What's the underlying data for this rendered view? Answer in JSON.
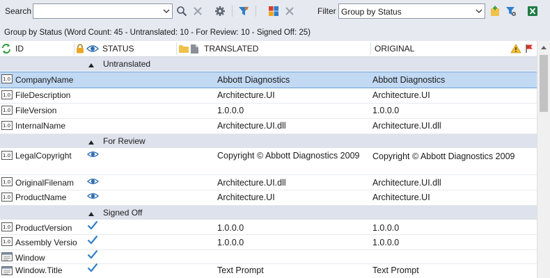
{
  "toolbar": {
    "search_label": "Search",
    "search_value": "",
    "filter_label": "Filter",
    "filter_value": "Group by Status"
  },
  "summary": "Group by Status (Word Count: 45 - Untranslated: 10 - For Review: 10 - Signed Off: 25)",
  "columns": {
    "id": "ID",
    "status": "STATUS",
    "translated": "TRANSLATED",
    "original": "ORIGINAL"
  },
  "groups": {
    "untranslated": "Untranslated",
    "for_review": "For Review",
    "signed_off": "Signed Off"
  },
  "rows": [
    {
      "id": "CompanyName",
      "translated": "Abbott Diagnostics",
      "original": "Abbott Diagnostics"
    },
    {
      "id": "FileDescription",
      "translated": "Architecture.UI",
      "original": "Architecture.UI"
    },
    {
      "id": "FileVersion",
      "translated": "1.0.0.0",
      "original": "1.0.0.0"
    },
    {
      "id": "InternalName",
      "translated": "Architecture.UI.dll",
      "original": "Architecture.UI.dll"
    },
    {
      "id": "LegalCopyright",
      "translated": "Copyright © Abbott Diagnostics 2009",
      "original": "Copyright © Abbott Diagnostics 2009"
    },
    {
      "id": "OriginalFilenam",
      "translated": "Architecture.UI.dll",
      "original": "Architecture.UI.dll"
    },
    {
      "id": "ProductName",
      "translated": "Architecture.UI",
      "original": "Architecture.UI"
    },
    {
      "id": "ProductVersion",
      "translated": "1.0.0.0",
      "original": "1.0.0.0"
    },
    {
      "id": "Assembly Versio",
      "translated": "1.0.0.0",
      "original": "1.0.0.0"
    },
    {
      "id": "Window",
      "translated": "",
      "original": ""
    },
    {
      "id": "Window.Title",
      "translated": "Text Prompt",
      "original": "Text Prompt"
    }
  ],
  "colors": {
    "toolbar_bg": "#e6e9f0",
    "group_bg": "#dde2ec",
    "selected_bg": "#c2d9f3",
    "accent_blue": "#2f7fc9"
  }
}
